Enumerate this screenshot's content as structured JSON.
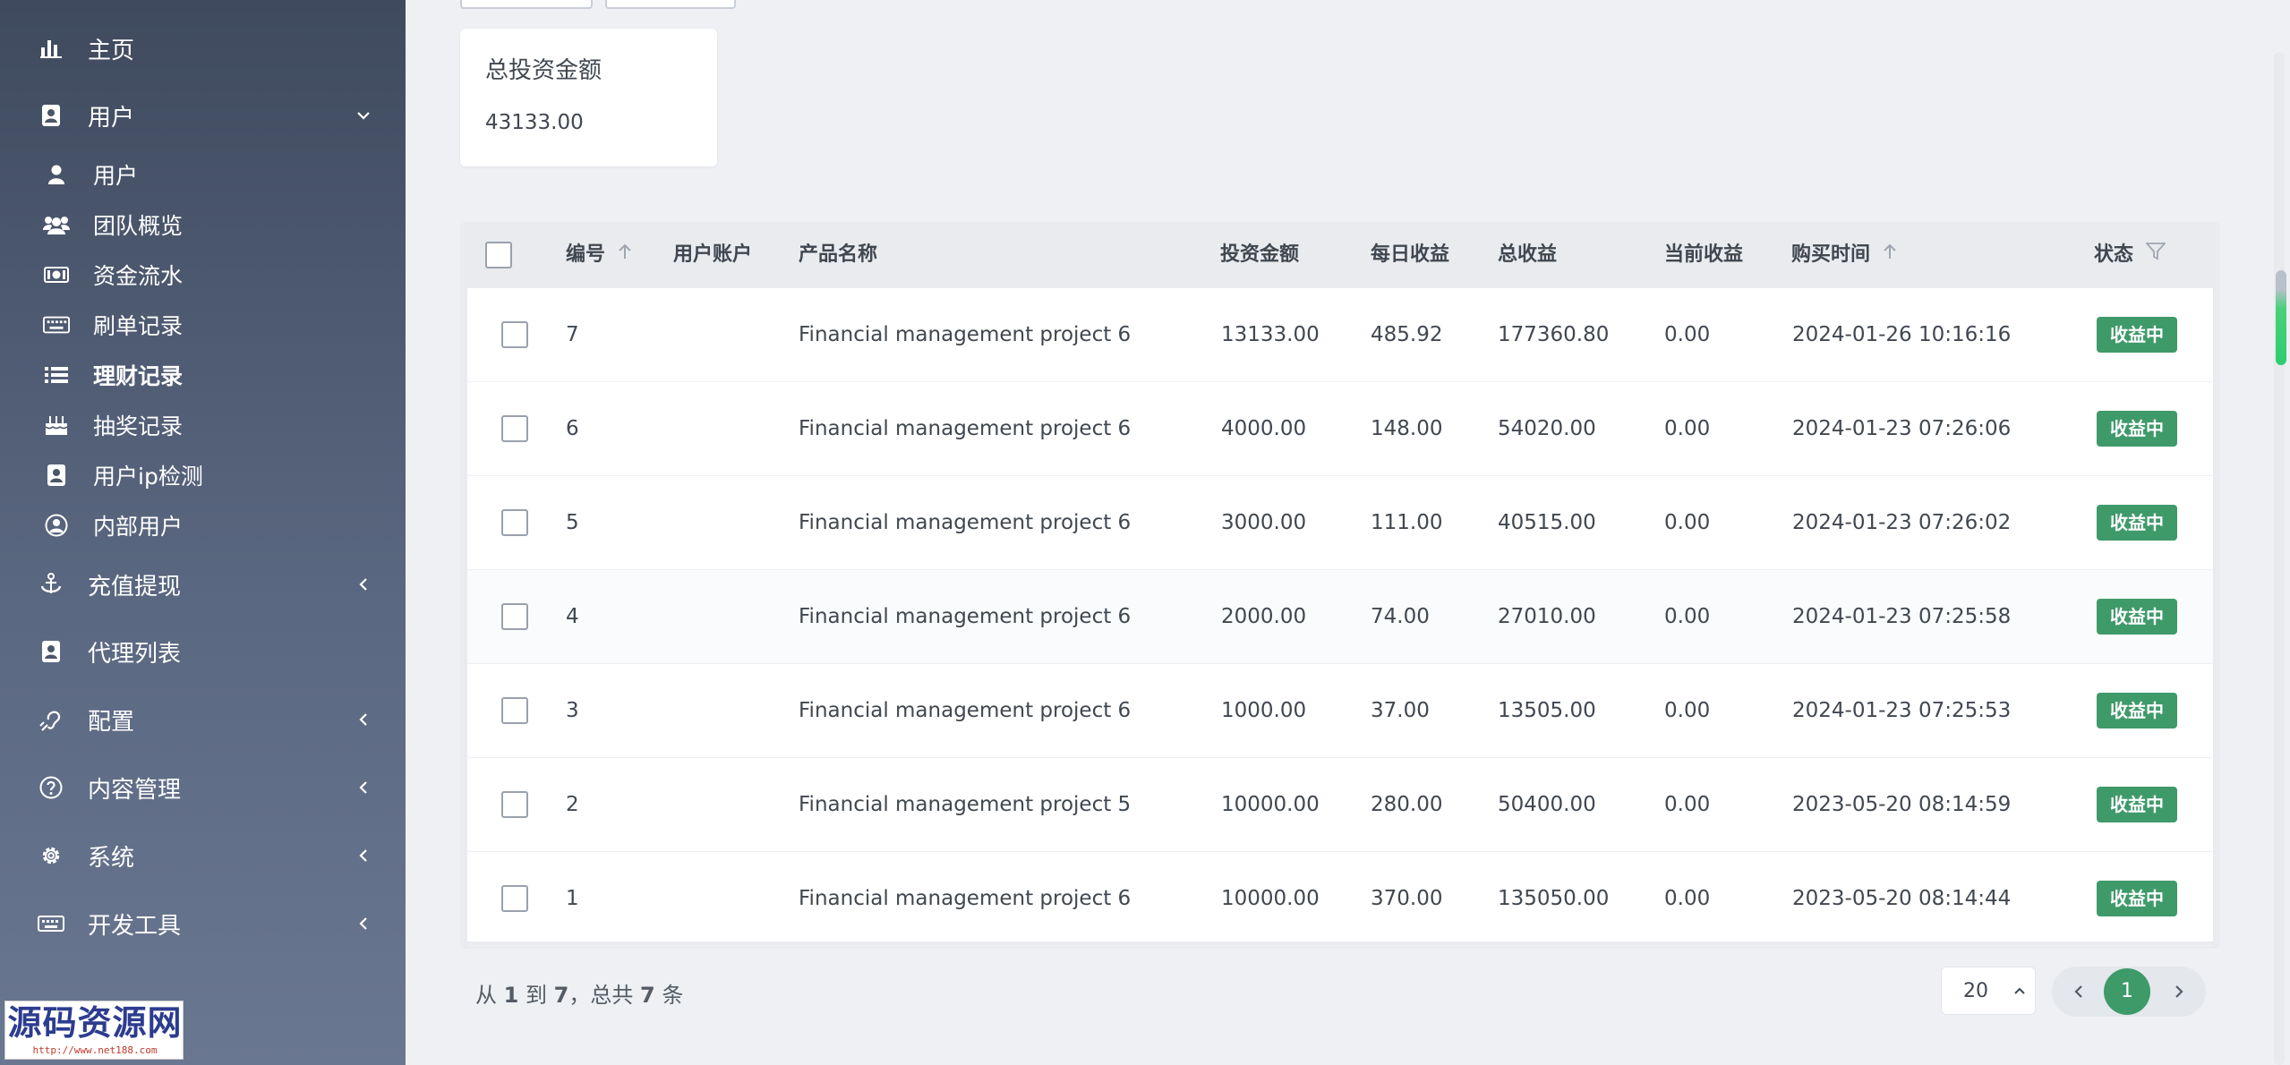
{
  "sidebar": {
    "items": [
      {
        "label": "主页",
        "icon": "bar-chart-icon"
      },
      {
        "label": "用户",
        "icon": "address-book-icon",
        "expanded": true
      },
      {
        "label": "用户",
        "icon": "user-icon"
      },
      {
        "label": "团队概览",
        "icon": "users-icon"
      },
      {
        "label": "资金流水",
        "icon": "money-bill-icon"
      },
      {
        "label": "刷单记录",
        "icon": "keyboard-icon"
      },
      {
        "label": "理财记录",
        "icon": "list-icon",
        "active": true
      },
      {
        "label": "抽奖记录",
        "icon": "birthday-cake-icon"
      },
      {
        "label": "用户ip检测",
        "icon": "address-book-icon"
      },
      {
        "label": "内部用户",
        "icon": "user-circle-icon"
      },
      {
        "label": "充值提现",
        "icon": "anchor-icon"
      },
      {
        "label": "代理列表",
        "icon": "address-book-icon"
      },
      {
        "label": "配置",
        "icon": "assistive-listening-icon"
      },
      {
        "label": "内容管理",
        "icon": "question-circle-icon"
      },
      {
        "label": "系统",
        "icon": "gear-icon"
      },
      {
        "label": "开发工具",
        "icon": "keyboard-icon"
      }
    ],
    "watermark": {
      "title": "源码资源网",
      "url": "http://www.net188.com"
    }
  },
  "stat": {
    "title": "总投资金额",
    "value": "43133.00"
  },
  "table": {
    "headers": {
      "id": "编号",
      "account": "用户账户",
      "product": "产品名称",
      "amount": "投资金额",
      "daily": "每日收益",
      "total": "总收益",
      "current": "当前收益",
      "time": "购买时间",
      "status": "状态"
    },
    "rows": [
      {
        "id": "7",
        "account": "",
        "product": "Financial management project 6",
        "amount": "13133.00",
        "daily": "485.92",
        "total": "177360.80",
        "current": "0.00",
        "time": "2024-01-26 10:16:16",
        "status": "收益中"
      },
      {
        "id": "6",
        "account": "",
        "product": "Financial management project 6",
        "amount": "4000.00",
        "daily": "148.00",
        "total": "54020.00",
        "current": "0.00",
        "time": "2024-01-23 07:26:06",
        "status": "收益中"
      },
      {
        "id": "5",
        "account": "",
        "product": "Financial management project 6",
        "amount": "3000.00",
        "daily": "111.00",
        "total": "40515.00",
        "current": "0.00",
        "time": "2024-01-23 07:26:02",
        "status": "收益中"
      },
      {
        "id": "4",
        "account": "",
        "product": "Financial management project 6",
        "amount": "2000.00",
        "daily": "74.00",
        "total": "27010.00",
        "current": "0.00",
        "time": "2024-01-23 07:25:58",
        "status": "收益中"
      },
      {
        "id": "3",
        "account": "",
        "product": "Financial management project 6",
        "amount": "1000.00",
        "daily": "37.00",
        "total": "13505.00",
        "current": "0.00",
        "time": "2024-01-23 07:25:53",
        "status": "收益中"
      },
      {
        "id": "2",
        "account": "",
        "product": "Financial management project 5",
        "amount": "10000.00",
        "daily": "280.00",
        "total": "50400.00",
        "current": "0.00",
        "time": "2023-05-20 08:14:59",
        "status": "收益中"
      },
      {
        "id": "1",
        "account": "",
        "product": "Financial management project 6",
        "amount": "10000.00",
        "daily": "370.00",
        "total": "135050.00",
        "current": "0.00",
        "time": "2023-05-20 08:14:44",
        "status": "收益中"
      }
    ]
  },
  "footer": {
    "prefix": "从",
    "from": "1",
    "to_word": "到",
    "to": "7",
    "total_word": "，总共",
    "total": "7",
    "suffix": "条"
  },
  "pagination": {
    "per_page": "20",
    "current_page": "1"
  },
  "colors": {
    "accent": "#3f9a6a",
    "sidebar_top": "#3f4a5e",
    "sidebar_bottom": "#6a7791"
  }
}
